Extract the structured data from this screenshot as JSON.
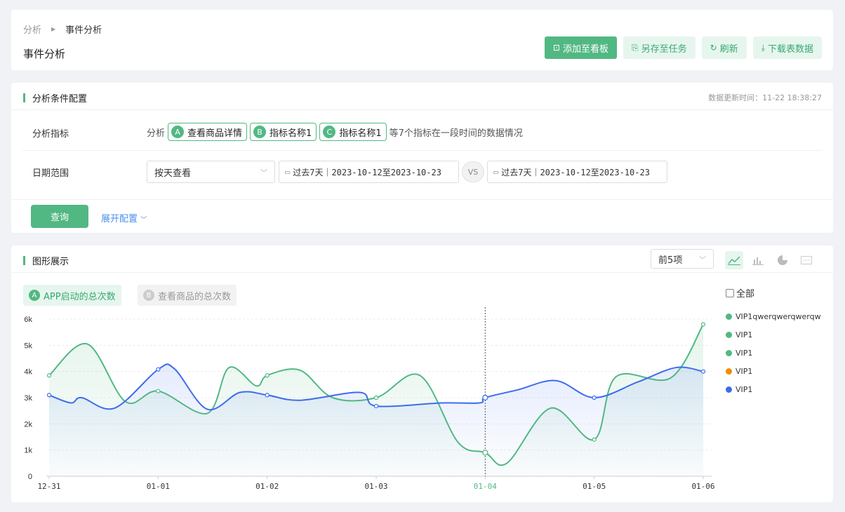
{
  "breadcrumb": {
    "parent": "分析",
    "current": "事件分析"
  },
  "page_title": "事件分析",
  "toolbar": {
    "add": "添加至看板",
    "save": "另存至任务",
    "refresh": "刷新",
    "download": "下载表数据"
  },
  "config": {
    "title": "分析条件配置",
    "update_time": "数据更新时间：11-22 18:38:27",
    "metric_label": "分析指标",
    "metric_prefix": "分析",
    "metrics": [
      {
        "letter": "A",
        "name": "查看商品详情"
      },
      {
        "letter": "B",
        "name": "指标名称1"
      },
      {
        "letter": "C",
        "name": "指标名称1"
      }
    ],
    "metric_suffix": "等7个指标在一段时间的数据情况",
    "date_label": "日期范围",
    "granularity": "按天查看",
    "range1": "过去7天｜2023-10-12至2023-10-23",
    "vs": "VS",
    "range2": "过去7天｜2023-10-12至2023-10-23",
    "query": "查询",
    "expand": "展开配置"
  },
  "chart_section": {
    "title": "图形展示",
    "topn": "前5项",
    "tab_a": "APP启动的总次数",
    "tab_b": "查看商品的总次数",
    "all_label": "全部",
    "legend": [
      {
        "name": "VIP1qwerqwerqwerqw",
        "color": "#52b883"
      },
      {
        "name": "VIP1",
        "color": "#52b883"
      },
      {
        "name": "VIP1",
        "color": "#52b883"
      },
      {
        "name": "VIP1",
        "color": "#f08c00"
      },
      {
        "name": "VIP1",
        "color": "#3b6cf0"
      }
    ]
  },
  "chart_data": {
    "type": "line",
    "x": [
      "12-31",
      "01-01",
      "01-02",
      "01-03",
      "01-04",
      "01-05",
      "01-06"
    ],
    "y_ticks": [
      "0",
      "1k",
      "2k",
      "3k",
      "4k",
      "5k",
      "6k"
    ],
    "ylim": [
      0,
      6000
    ],
    "highlight_x": "01-04",
    "series": [
      {
        "name": "APP启动的总次数",
        "color": "#52b883",
        "values": [
          3850,
          3250,
          3850,
          3000,
          900,
          1400,
          5800
        ],
        "interp": [
          [
            0.35,
            5050
          ],
          [
            0.7,
            2850
          ],
          [
            1.45,
            2400
          ],
          [
            1.65,
            4150
          ],
          [
            1.9,
            3450
          ],
          [
            2.3,
            4050
          ],
          [
            2.6,
            3000
          ],
          [
            3.4,
            3850
          ],
          [
            3.75,
            1300
          ],
          [
            4.2,
            500
          ],
          [
            4.6,
            2600
          ],
          [
            5.2,
            3800
          ],
          [
            5.7,
            3750
          ]
        ]
      },
      {
        "name": "查看商品的总次数",
        "color": "#3b6cf0",
        "values": [
          3100,
          4080,
          3100,
          2680,
          3000,
          3000,
          4000
        ],
        "interp": [
          [
            0.2,
            2800
          ],
          [
            0.3,
            3000
          ],
          [
            0.6,
            2600
          ],
          [
            1.15,
            4100
          ],
          [
            1.45,
            2560
          ],
          [
            1.75,
            3200
          ],
          [
            2.3,
            2900
          ],
          [
            2.85,
            3200
          ],
          [
            3.6,
            2800
          ],
          [
            3.95,
            2800
          ],
          [
            4.3,
            3300
          ],
          [
            4.65,
            3650
          ],
          [
            5.4,
            3600
          ],
          [
            5.75,
            4150
          ]
        ]
      }
    ]
  }
}
